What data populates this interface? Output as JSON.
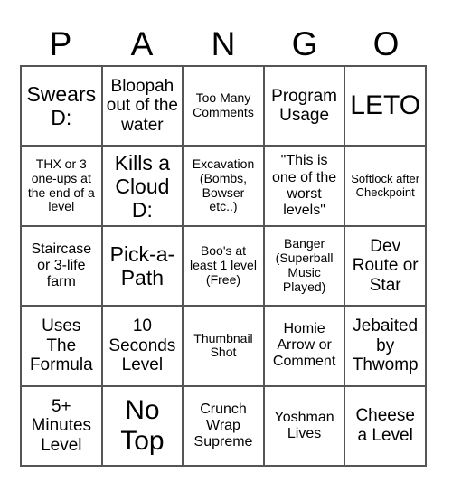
{
  "card": {
    "header_letters": [
      "P",
      "A",
      "N",
      "G",
      "O"
    ],
    "rows": [
      [
        {
          "text": "Swears D:",
          "size": "fs-lg"
        },
        {
          "text": "Bloopah out of the water",
          "size": "fs-md"
        },
        {
          "text": "Too Many Comments",
          "size": "fs-xs"
        },
        {
          "text": "Program Usage",
          "size": "fs-md"
        },
        {
          "text": "LETO",
          "size": "fs-xl"
        }
      ],
      [
        {
          "text": "THX or 3 one-ups at the end of a level",
          "size": "fs-xs"
        },
        {
          "text": "Kills a Cloud D:",
          "size": "fs-lg"
        },
        {
          "text": "Excavation (Bombs, Bowser etc..)",
          "size": "fs-xs"
        },
        {
          "text": "\"This is one of the worst levels\"",
          "size": "fs-sm"
        },
        {
          "text": "Softlock after Checkpoint",
          "size": "fs-xxs"
        }
      ],
      [
        {
          "text": "Staircase or 3-life farm",
          "size": "fs-sm"
        },
        {
          "text": "Pick-a-Path",
          "size": "fs-lg"
        },
        {
          "text": "Boo's at least 1 level (Free)",
          "size": "fs-xs"
        },
        {
          "text": "Banger (Superball Music Played)",
          "size": "fs-xs"
        },
        {
          "text": "Dev Route or Star",
          "size": "fs-md"
        }
      ],
      [
        {
          "text": "Uses The Formula",
          "size": "fs-md"
        },
        {
          "text": "10 Seconds Level",
          "size": "fs-md"
        },
        {
          "text": "Thumbnail Shot",
          "size": "fs-xs"
        },
        {
          "text": "Homie Arrow or Comment",
          "size": "fs-sm"
        },
        {
          "text": "Jebaited by Thwomp",
          "size": "fs-md"
        }
      ],
      [
        {
          "text": "5+ Minutes Level",
          "size": "fs-md"
        },
        {
          "text": "No Top",
          "size": "fs-xl"
        },
        {
          "text": "Crunch Wrap Supreme",
          "size": "fs-sm"
        },
        {
          "text": "Yoshman Lives",
          "size": "fs-sm"
        },
        {
          "text": "Cheese a Level",
          "size": "fs-md"
        }
      ]
    ]
  },
  "colors": {
    "border": "#555555",
    "text": "#000000",
    "background": "#ffffff"
  }
}
